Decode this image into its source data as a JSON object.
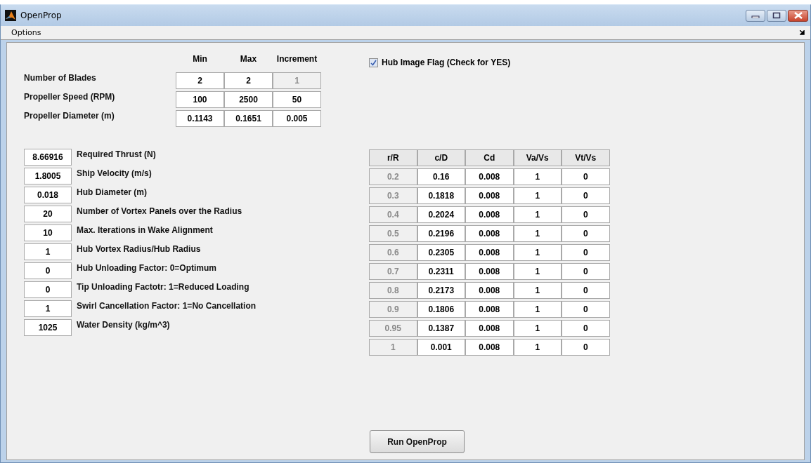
{
  "window": {
    "title": "OpenProp"
  },
  "menu": [
    "Options"
  ],
  "range_table": {
    "columns": [
      "Min",
      "Max",
      "Increment"
    ],
    "rows": [
      {
        "label": "Number of Blades",
        "cells": [
          {
            "value": "2",
            "disabled": false
          },
          {
            "value": "2",
            "disabled": false
          },
          {
            "value": "1",
            "disabled": true
          }
        ]
      },
      {
        "label": "Propeller Speed (RPM)",
        "cells": [
          {
            "value": "100",
            "disabled": false
          },
          {
            "value": "2500",
            "disabled": false
          },
          {
            "value": "50",
            "disabled": false
          }
        ]
      },
      {
        "label": "Propeller Diameter (m)",
        "cells": [
          {
            "value": "0.1143",
            "disabled": false
          },
          {
            "value": "0.1651",
            "disabled": false
          },
          {
            "value": "0.005",
            "disabled": false
          }
        ]
      }
    ]
  },
  "hub_image_flag": {
    "label": "Hub Image Flag (Check for YES)",
    "checked": true
  },
  "parameters": [
    {
      "value": "8.66916",
      "label": "Required Thrust (N)"
    },
    {
      "value": "1.8005",
      "label": "Ship Velocity (m/s)"
    },
    {
      "value": "0.018",
      "label": "Hub Diameter (m)"
    },
    {
      "value": "20",
      "label": "Number of Vortex Panels over the Radius"
    },
    {
      "value": "10",
      "label": "Max. Iterations in Wake Alignment"
    },
    {
      "value": "1",
      "label": "Hub Vortex Radius/Hub Radius"
    },
    {
      "value": "0",
      "label": "Hub Unloading Factor: 0=Optimum"
    },
    {
      "value": "0",
      "label": "Tip Unloading Factotr: 1=Reduced Loading"
    },
    {
      "value": "1",
      "label": "Swirl Cancellation Factor: 1=No Cancellation"
    },
    {
      "value": "1025",
      "label": "Water Density (kg/m^3)"
    }
  ],
  "blade_table": {
    "columns": [
      {
        "label": "r/R",
        "disabled": true
      },
      {
        "label": "c/D",
        "disabled": false
      },
      {
        "label": "Cd",
        "disabled": false
      },
      {
        "label": "Va/Vs",
        "disabled": false
      },
      {
        "label": "Vt/Vs",
        "disabled": false
      }
    ],
    "rows": [
      [
        "0.2",
        "0.16",
        "0.008",
        "1",
        "0"
      ],
      [
        "0.3",
        "0.1818",
        "0.008",
        "1",
        "0"
      ],
      [
        "0.4",
        "0.2024",
        "0.008",
        "1",
        "0"
      ],
      [
        "0.5",
        "0.2196",
        "0.008",
        "1",
        "0"
      ],
      [
        "0.6",
        "0.2305",
        "0.008",
        "1",
        "0"
      ],
      [
        "0.7",
        "0.2311",
        "0.008",
        "1",
        "0"
      ],
      [
        "0.8",
        "0.2173",
        "0.008",
        "1",
        "0"
      ],
      [
        "0.9",
        "0.1806",
        "0.008",
        "1",
        "0"
      ],
      [
        "0.95",
        "0.1387",
        "0.008",
        "1",
        "0"
      ],
      [
        "1",
        "0.001",
        "0.008",
        "1",
        "0"
      ]
    ]
  },
  "run_button": {
    "label": "Run OpenProp"
  }
}
